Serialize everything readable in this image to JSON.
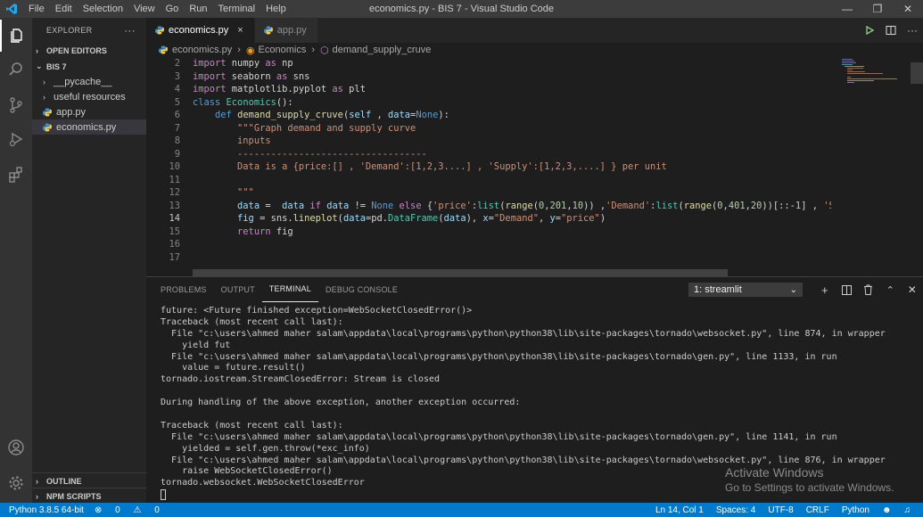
{
  "window": {
    "title": "economics.py - BIS 7 - Visual Studio Code",
    "menu": [
      "File",
      "Edit",
      "Selection",
      "View",
      "Go",
      "Run",
      "Terminal",
      "Help"
    ]
  },
  "explorer": {
    "title": "EXPLORER",
    "more": "···",
    "open_editors": "OPEN EDITORS",
    "workspace": "BIS 7",
    "items": [
      {
        "label": "__pycache__",
        "type": "folder"
      },
      {
        "label": "useful resources",
        "type": "folder"
      },
      {
        "label": "app.py",
        "type": "file"
      },
      {
        "label": "economics.py",
        "type": "file",
        "selected": true
      }
    ],
    "outline": "OUTLINE",
    "npm_scripts": "NPM SCRIPTS"
  },
  "tabs": [
    {
      "label": "economics.py",
      "active": true,
      "close": "×"
    },
    {
      "label": "app.py",
      "active": false
    }
  ],
  "breadcrumb": [
    "economics.py",
    "Economics",
    "demand_supply_cruve"
  ],
  "editor": {
    "current_line": 14,
    "line_numbers": [
      2,
      3,
      4,
      5,
      6,
      7,
      8,
      9,
      10,
      11,
      12,
      13,
      14,
      15,
      16,
      17
    ]
  },
  "panel": {
    "tabs": [
      "PROBLEMS",
      "OUTPUT",
      "TERMINAL",
      "DEBUG CONSOLE"
    ],
    "active_tab": "TERMINAL",
    "terminal_select": "1: streamlit",
    "terminal_lines": [
      "future: <Future finished exception=WebSocketClosedError()>",
      "Traceback (most recent call last):",
      "  File \"c:\\users\\ahmed maher salam\\appdata\\local\\programs\\python\\python38\\lib\\site-packages\\tornado\\websocket.py\", line 874, in wrapper",
      "    yield fut",
      "  File \"c:\\users\\ahmed maher salam\\appdata\\local\\programs\\python\\python38\\lib\\site-packages\\tornado\\gen.py\", line 1133, in run",
      "    value = future.result()",
      "tornado.iostream.StreamClosedError: Stream is closed",
      "",
      "During handling of the above exception, another exception occurred:",
      "",
      "Traceback (most recent call last):",
      "  File \"c:\\users\\ahmed maher salam\\appdata\\local\\programs\\python\\python38\\lib\\site-packages\\tornado\\gen.py\", line 1141, in run",
      "    yielded = self.gen.throw(*exc_info)",
      "  File \"c:\\users\\ahmed maher salam\\appdata\\local\\programs\\python\\python38\\lib\\site-packages\\tornado\\websocket.py\", line 876, in wrapper",
      "    raise WebSocketClosedError()",
      "tornado.websocket.WebSocketClosedError"
    ]
  },
  "watermark": {
    "line1": "Activate Windows",
    "line2": "Go to Settings to activate Windows."
  },
  "status": {
    "python": "Python 3.8.5 64-bit",
    "problems": "0",
    "warnings": "0",
    "position": "Ln 14, Col 1",
    "spaces": "Spaces: 4",
    "encoding": "UTF-8",
    "eol": "CRLF",
    "language": "Python"
  }
}
